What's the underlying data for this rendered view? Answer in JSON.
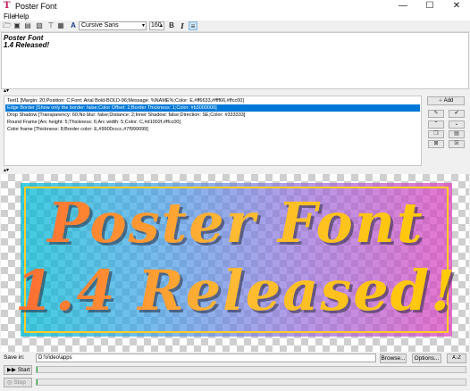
{
  "window": {
    "title": "Poster Font",
    "app_icon": "font-app-icon",
    "controls": [
      "—",
      "☐",
      "✕"
    ]
  },
  "menu": [
    "File",
    "Help"
  ],
  "toolbar": {
    "font": "Cursive Sans",
    "size": "160",
    "bold": "B",
    "italic": "I"
  },
  "editor": {
    "lines": [
      "Poster Font",
      "1.4 Released!"
    ]
  },
  "frames": [
    "Text1 [Margin: 20;Position: C;Font: Arial Bold-BOLD-96;Message: %NAME%;Color: E,#ff6633,#ffff66,#ffcc00]",
    "Edge Border [Show only the border: false;Color Offset: 2;Border Thickness: 1;Color: #b3000000]",
    "Drop Shadow [Transparency: 60;No blur: false;Distance: 2;Inner Shadow: false;Direction: SE;Color: #333333]",
    "Round Frame [Arc height: 5;Thickness: 6;Arc width: 5;Color: C,#d1002f,#ffcc00]",
    "Color frame [Thickness: 8;Border color: E,#9900cccc,#7f990099]"
  ],
  "selected_frame_index": 1,
  "side_buttons": {
    "add": "Add"
  },
  "poster": {
    "lines": [
      "Poster Font",
      "1.4 Released!"
    ]
  },
  "save": {
    "label": "Save in:",
    "path": "D:\\Video\\apps",
    "browse": "Browse...",
    "options": "Options...",
    "sort_icon": "A↓Z"
  },
  "start": {
    "label": "Start",
    "progress": 0.0
  },
  "stop": {
    "label": "Stop",
    "progress": 0.0
  },
  "colors": {
    "selection": "#0078d7",
    "border_gold": "#ffcc22",
    "progress": "#06b025"
  }
}
